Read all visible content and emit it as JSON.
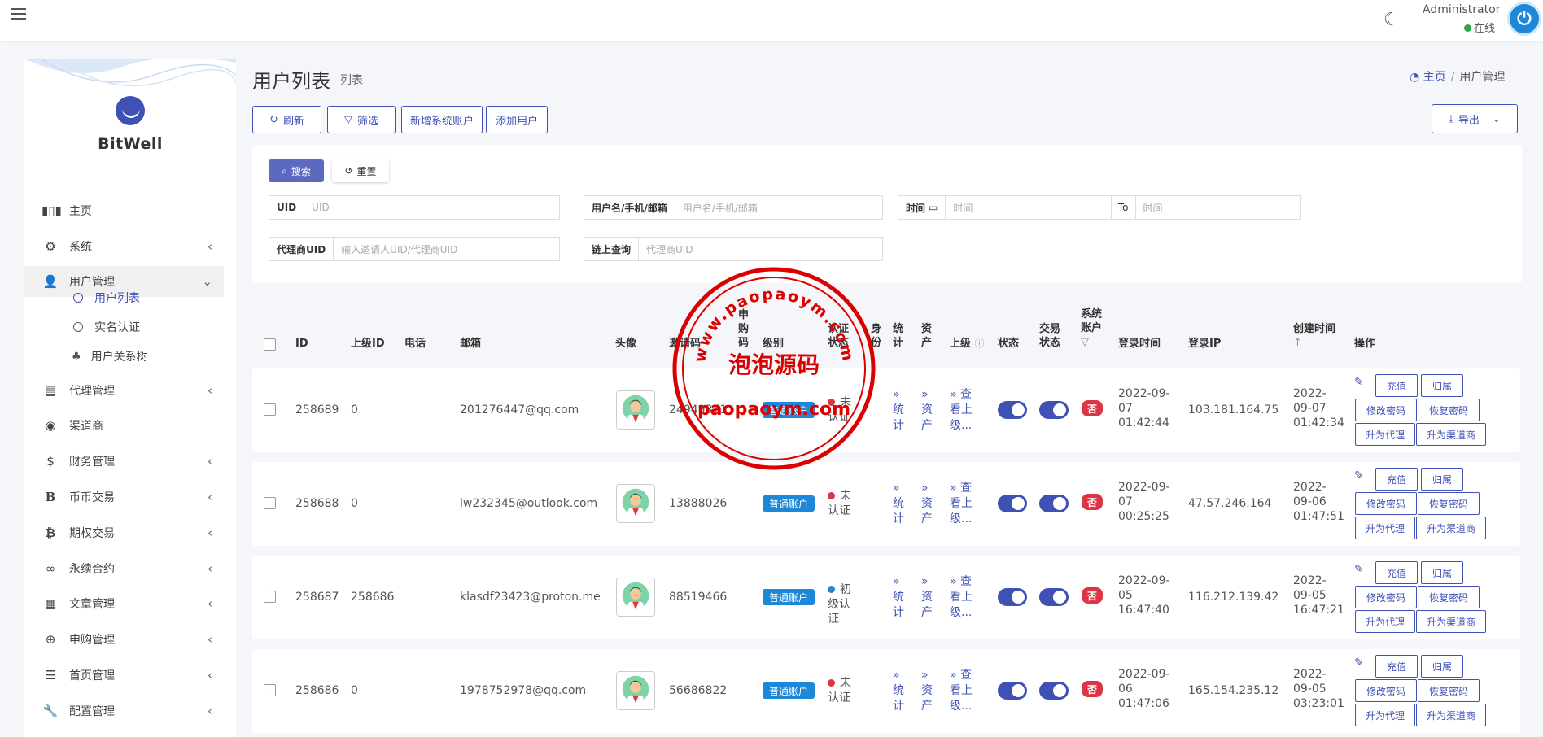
{
  "topbar": {
    "admin_name": "Administrator",
    "status": "在线"
  },
  "sidebar": {
    "brand": "BitWell",
    "items": [
      {
        "label": "主页",
        "icon": "bar-chart-icon"
      },
      {
        "label": "系统",
        "icon": "gear-icon"
      },
      {
        "label": "用户管理",
        "icon": "users-icon"
      },
      {
        "label": "代理管理",
        "icon": "id-card-icon"
      },
      {
        "label": "渠道商",
        "icon": "user-circle-icon"
      },
      {
        "label": "财务管理",
        "icon": "dollar-icon"
      },
      {
        "label": "币币交易",
        "icon": "bitcoin-b-icon"
      },
      {
        "label": "期权交易",
        "icon": "bitcoin-icon"
      },
      {
        "label": "永续合约",
        "icon": "link-icon"
      },
      {
        "label": "文章管理",
        "icon": "newspaper-icon"
      },
      {
        "label": "申购管理",
        "icon": "lifebuoy-icon"
      },
      {
        "label": "首页管理",
        "icon": "list-icon"
      },
      {
        "label": "配置管理",
        "icon": "wrench-icon"
      }
    ],
    "sub_items": [
      {
        "label": "用户列表"
      },
      {
        "label": "实名认证"
      },
      {
        "label": "用户关系树"
      }
    ]
  },
  "header": {
    "title": "用户列表",
    "subtitle": "列表",
    "breadcrumb_home": "主页",
    "breadcrumb_current": "用户管理"
  },
  "toolbar": {
    "refresh": "刷新",
    "filter": "筛选",
    "add_system": "新增系统账户",
    "add_user": "添加用户",
    "export": "导出"
  },
  "search": {
    "search_btn": "搜索",
    "reset_btn": "重置",
    "uid_label": "UID",
    "uid_placeholder": "UID",
    "name_label": "用户名/手机/邮箱",
    "name_placeholder": "用户名/手机/邮箱",
    "time_label": "时间",
    "time_placeholder": "时间",
    "to_label": "To",
    "time_to_placeholder": "时间",
    "agent_label": "代理商UID",
    "agent_placeholder": "输入邀请人UID/代理商UID",
    "chain_label": "链上查询",
    "chain_placeholder": "代理商UID"
  },
  "table": {
    "headers": {
      "id": "ID",
      "parent_id": "上级ID",
      "phone": "电话",
      "email": "邮箱",
      "avatar": "头像",
      "invite": "邀请码",
      "apply_l1": "申",
      "apply_l2": "购",
      "apply_l3": "码",
      "level": "级别",
      "auth_l1": "认证",
      "auth_l2": "状态",
      "identity_l1": "身",
      "identity_l2": "份",
      "stats_l1": "统",
      "stats_l2": "计",
      "assets_l1": "资",
      "assets_l2": "产",
      "superior": "上级",
      "status": "状态",
      "trade_l1": "交易",
      "trade_l2": "状态",
      "sys_l1": "系统",
      "sys_l2": "账户",
      "login_time": "登录时间",
      "login_ip": "登录IP",
      "created": "创建时间",
      "actions": "操作"
    },
    "rows": [
      {
        "id": "258689",
        "parent_id": "0",
        "email": "201276447@qq.com",
        "invite": "24949371",
        "level": "普通账户",
        "auth_l1": "未",
        "auth_l2": "认证",
        "auth_l3": "",
        "auth_color": "#dc3545",
        "sys": "否",
        "login_l1": "2022-09-",
        "login_l2": "07",
        "login_l3": "01:42:44",
        "ip": "103.181.164.75",
        "created_l1": "2022-",
        "created_l2": "09-07",
        "created_l3": "01:42:34"
      },
      {
        "id": "258688",
        "parent_id": "0",
        "email": "lw232345@outlook.com",
        "invite": "13888026",
        "level": "普通账户",
        "auth_l1": "未",
        "auth_l2": "认证",
        "auth_l3": "",
        "auth_color": "#dc3545",
        "sys": "否",
        "login_l1": "2022-09-",
        "login_l2": "07",
        "login_l3": "00:25:25",
        "ip": "47.57.246.164",
        "created_l1": "2022-",
        "created_l2": "09-06",
        "created_l3": "01:47:51"
      },
      {
        "id": "258687",
        "parent_id": "258686",
        "email": "klasdf23423@proton.me",
        "invite": "88519466",
        "level": "普通账户",
        "auth_l1": "初",
        "auth_l2": "级认",
        "auth_l3": "证",
        "auth_color": "#1e88d8",
        "sys": "否",
        "login_l1": "2022-09-",
        "login_l2": "05",
        "login_l3": "16:47:40",
        "ip": "116.212.139.42",
        "created_l1": "2022-",
        "created_l2": "09-05",
        "created_l3": "16:47:21"
      },
      {
        "id": "258686",
        "parent_id": "0",
        "email": "1978752978@qq.com",
        "invite": "56686822",
        "level": "普通账户",
        "auth_l1": "未",
        "auth_l2": "认证",
        "auth_l3": "",
        "auth_color": "#dc3545",
        "sys": "否",
        "login_l1": "2022-09-",
        "login_l2": "06",
        "login_l3": "01:47:06",
        "ip": "165.154.235.12",
        "created_l1": "2022-",
        "created_l2": "09-05",
        "created_l3": "03:23:01"
      }
    ],
    "row_links": {
      "stats_l1": "»",
      "stats_l2": "统",
      "stats_l3": "计",
      "assets_l1": "»",
      "assets_l2": "资",
      "assets_l3": "产",
      "sup_l1": "» 查",
      "sup_l2": "看上",
      "sup_l3": "级..."
    },
    "row_actions": {
      "recharge": "充值",
      "attribute": "归属",
      "change_pwd": "修改密码",
      "restore_pwd": "恢复密码",
      "to_agent": "升为代理",
      "to_channel": "升为渠道商"
    }
  },
  "watermark": {
    "top_text": "www.paopaoym.com",
    "center_text": "泡泡源码",
    "bottom_text": "paopaoym.com"
  }
}
